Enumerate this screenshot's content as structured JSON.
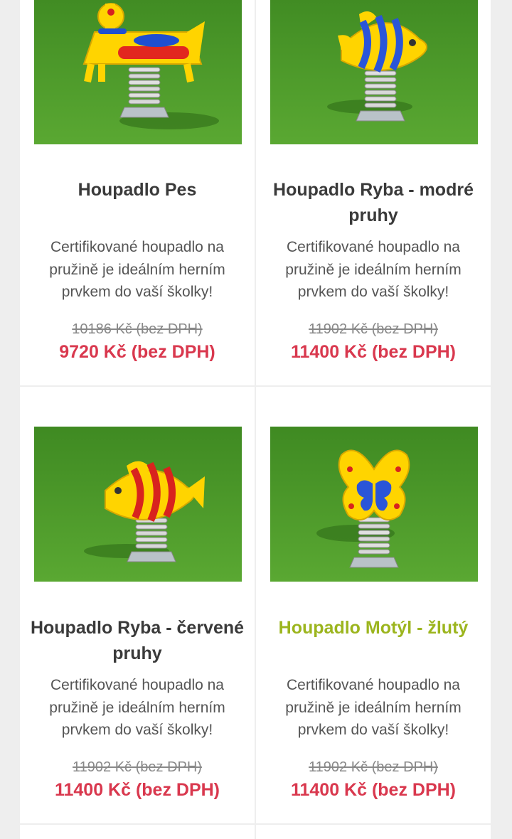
{
  "products": [
    {
      "name": "Houpadlo Pes",
      "description": "Certifikované houpadlo na pružině je ideálním herním prvkem do vaší školky!",
      "old_price": "10186 Kč (bez DPH)",
      "price": "9720 Kč (bez DPH)",
      "image": "houpadlo-pes-image"
    },
    {
      "name": "Houpadlo Ryba - modré pruhy",
      "description": "Certifikované houpadlo na pružině je ideálním herním prvkem do vaší školky!",
      "old_price": "11902 Kč (bez DPH)",
      "price": "11400 Kč (bez DPH)",
      "image": "houpadlo-ryba-modre-image"
    },
    {
      "name": "Houpadlo Ryba - červené pruhy",
      "description": "Certifikované houpadlo na pružině je ideálním herním prvkem do vaší školky!",
      "old_price": "11902 Kč (bez DPH)",
      "price": "11400 Kč (bez DPH)",
      "image": "houpadlo-ryba-cervene-image"
    },
    {
      "name": "Houpadlo Motýl - žlutý",
      "description": "Certifikované houpadlo na pružině je ideálním herním prvkem do vaší školky!",
      "old_price": "11902 Kč (bez DPH)",
      "price": "11400 Kč (bez DPH)",
      "image": "houpadlo-motyl-image"
    }
  ],
  "colors": {
    "title": "#3a3a3a",
    "title_highlight": "#9cb51e",
    "price": "#d9384e",
    "old_price": "#888888",
    "grass": "#4e9a2c"
  }
}
